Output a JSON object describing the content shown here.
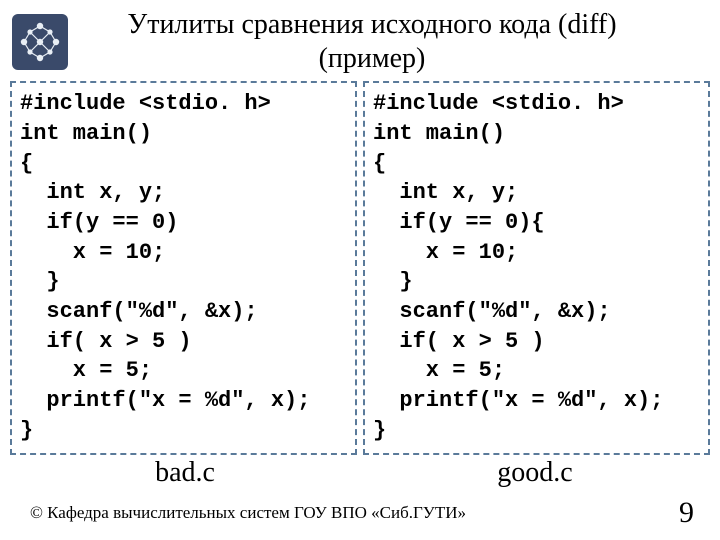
{
  "title_line1": "Утилиты сравнения исходного кода (diff)",
  "title_line2": "(пример)",
  "code_left": "#include <stdio. h>\nint main()\n{\n  int x, y;\n  if(y == 0)\n    x = 10;\n  }\n  scanf(\"%d\", &x);\n  if( x > 5 )\n    x = 5;\n  printf(\"x = %d\", x);\n}",
  "code_right": "#include <stdio. h>\nint main()\n{\n  int x, y;\n  if(y == 0){\n    x = 10;\n  }\n  scanf(\"%d\", &x);\n  if( x > 5 )\n    x = 5;\n  printf(\"x = %d\", x);\n}",
  "label_left": "bad.c",
  "label_right": "good.c",
  "copyright": "© Кафедра вычислительных систем ГОУ ВПО «Сиб.ГУТИ»",
  "page_number": "9"
}
